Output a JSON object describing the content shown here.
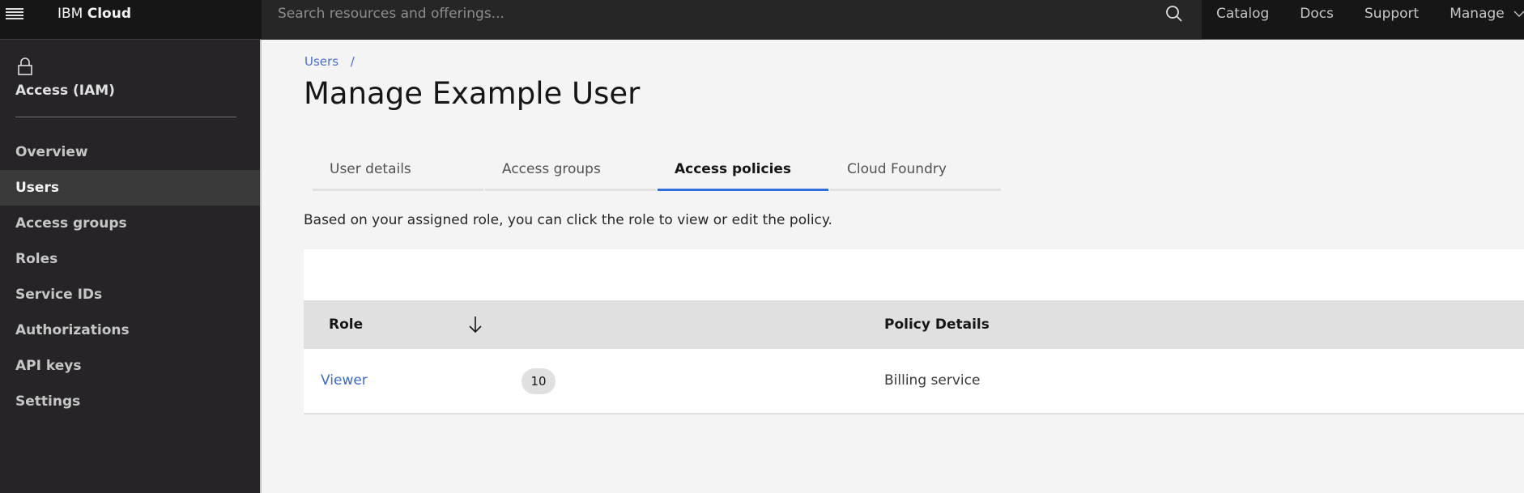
{
  "header": {
    "brand_prefix": "IBM",
    "brand_name": "Cloud",
    "search_placeholder": "Search resources and offerings...",
    "nav": [
      "Catalog",
      "Docs",
      "Support",
      "Manage"
    ]
  },
  "sidebar": {
    "title": "Access (IAM)",
    "items": [
      {
        "label": "Overview",
        "active": false
      },
      {
        "label": "Users",
        "active": true
      },
      {
        "label": "Access groups",
        "active": false
      },
      {
        "label": "Roles",
        "active": false
      },
      {
        "label": "Service IDs",
        "active": false
      },
      {
        "label": "Authorizations",
        "active": false
      },
      {
        "label": "API keys",
        "active": false
      },
      {
        "label": "Settings",
        "active": false
      }
    ]
  },
  "main": {
    "breadcrumb": {
      "link": "Users",
      "separator": "/"
    },
    "title": "Manage Example User",
    "tabs": [
      {
        "label": "User details",
        "active": false
      },
      {
        "label": "Access groups",
        "active": false
      },
      {
        "label": "Access policies",
        "active": true
      },
      {
        "label": "Cloud Foundry",
        "active": false
      }
    ],
    "description": "Based on your assigned role, you can click the role to view or edit the policy.",
    "table": {
      "columns": [
        "Role",
        "Policy Details"
      ],
      "rows": [
        {
          "role": "Viewer",
          "count": "10",
          "policy_details": "Billing service"
        }
      ]
    }
  },
  "colors": {
    "accent": "#2f6ddb",
    "link": "#3c6bc9",
    "header_bg": "#161616",
    "sidebar_bg": "#262427"
  }
}
